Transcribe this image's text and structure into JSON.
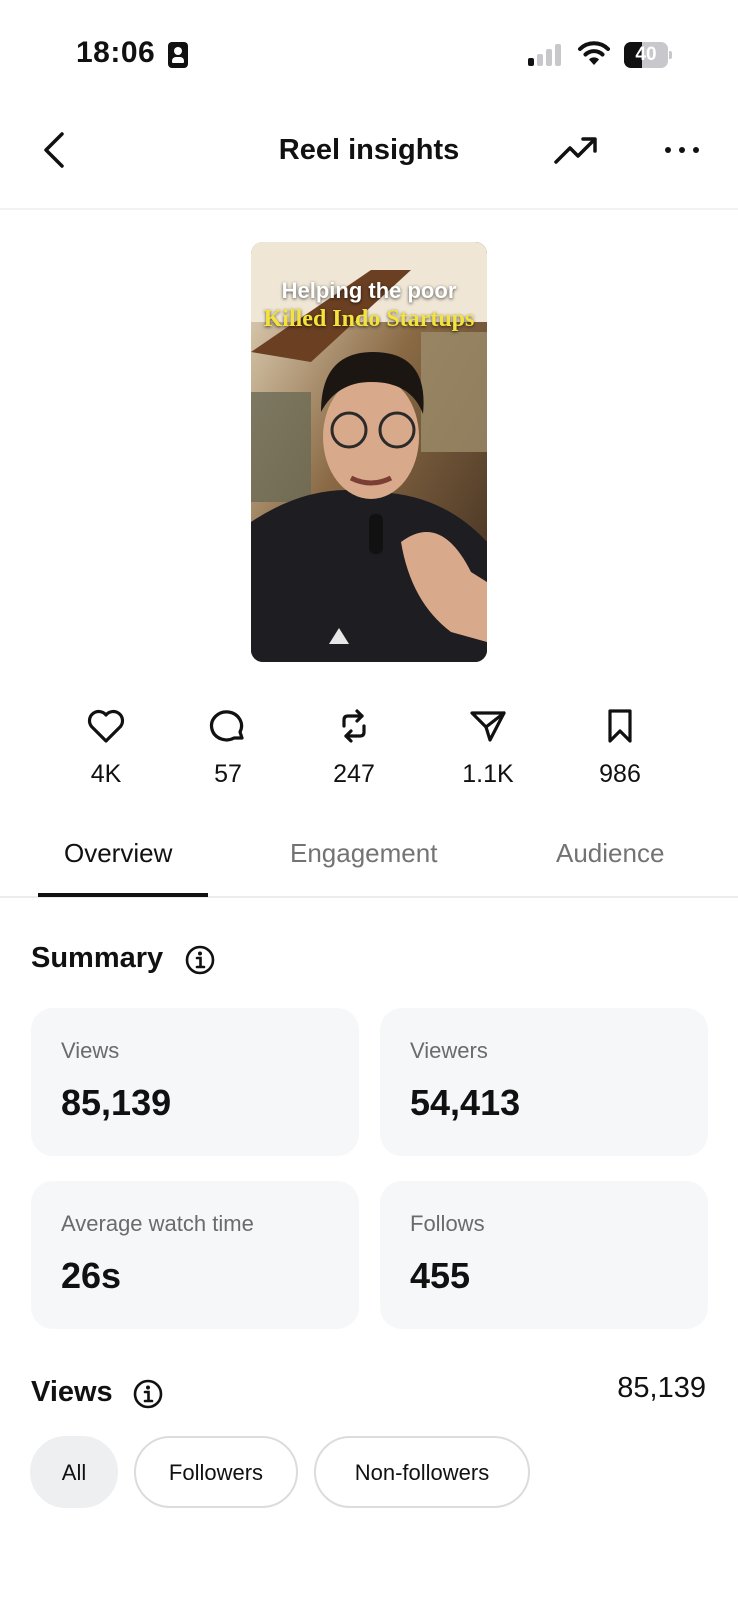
{
  "status_bar": {
    "time": "18:06",
    "battery": "40",
    "battery_level": 0.4,
    "signal_bars_active": 1
  },
  "header": {
    "title": "Reel insights",
    "back_icon": "chevron-left-icon",
    "trend_icon": "trending-up-icon",
    "more_icon": "more-horizontal-icon"
  },
  "reel": {
    "caption_line1": "Helping the poor",
    "caption_line2": "Killed Indo Startups"
  },
  "stats": [
    {
      "icon": "heart-icon",
      "value": "4K"
    },
    {
      "icon": "comment-icon",
      "value": "57"
    },
    {
      "icon": "repost-icon",
      "value": "247"
    },
    {
      "icon": "share-icon",
      "value": "1.1K"
    },
    {
      "icon": "bookmark-icon",
      "value": "986"
    }
  ],
  "tabs": [
    {
      "label": "Overview",
      "active": true
    },
    {
      "label": "Engagement",
      "active": false
    },
    {
      "label": "Audience",
      "active": false
    }
  ],
  "summary": {
    "title": "Summary",
    "cards": [
      {
        "label": "Views",
        "value": "85,139"
      },
      {
        "label": "Viewers",
        "value": "54,413"
      },
      {
        "label": "Average watch time",
        "value": "26s"
      },
      {
        "label": "Follows",
        "value": "455"
      }
    ]
  },
  "views_section": {
    "title": "Views",
    "total": "85,139",
    "filters": [
      {
        "label": "All",
        "active": true
      },
      {
        "label": "Followers",
        "active": false
      },
      {
        "label": "Non-followers",
        "active": false
      }
    ]
  },
  "colors": {
    "text": "#111111",
    "muted": "#737373",
    "card_bg": "#f6f7f8",
    "caption_yellow": "#f5e23a"
  }
}
